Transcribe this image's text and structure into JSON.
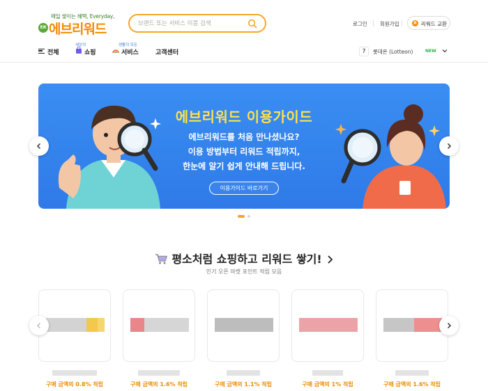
{
  "header": {
    "logo_tagline": "매일 쌓이는 혜택, Everyday,",
    "logo_badge": "ER",
    "logo_text": "에브리워드",
    "search_placeholder": "브랜드 또는 서비스 이름 검색",
    "login": "로그인",
    "signup": "회원가입",
    "exchange_icon": "R",
    "exchange": "리워드 교환"
  },
  "nav": {
    "all": "전체",
    "shopping_sub": "세상의",
    "shopping": "쇼핑",
    "service_sub": "생활의 모든",
    "service": "서비스",
    "support": "고객센터",
    "rank_number": "7",
    "rank_item": "롯데온 (Lotteon)",
    "rank_badge": "NEW"
  },
  "banner": {
    "title": "에브리워드 이용가이드",
    "lines": [
      "에브리워드를 처음 만나셨나요?",
      "이용 방법부터 리워드 적립까지,",
      "한눈에 알기 쉽게 안내해 드립니다."
    ],
    "button": "이용가이드 바로가기",
    "slide_count": 2,
    "active_slide": 1
  },
  "section": {
    "title": "평소처럼 쇼핑하고 리워드 쌓기!",
    "subtitle": "인기 오픈 마켓 포인트 적립 모음",
    "cards": [
      {
        "rate": "구매 금액의 0.8% 적립"
      },
      {
        "rate": "구매 금액의 1.6% 적립"
      },
      {
        "rate": "구매 금액의 1.1% 적립"
      },
      {
        "rate": "구매 금액의 1% 적립"
      },
      {
        "rate": "구매 금액의 1.6% 적립"
      }
    ]
  },
  "colors": {
    "accent": "#f6a623",
    "brand_orange": "#f08c00",
    "banner_blue": "#3a8ef2",
    "banner_title": "#ffe14a"
  }
}
